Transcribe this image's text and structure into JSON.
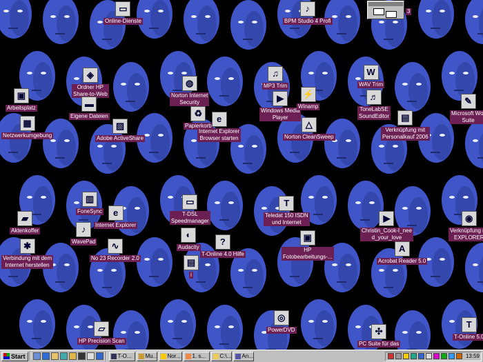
{
  "colors": {
    "label_bg": "#6b1f52",
    "label_text": "#ffffff",
    "face": "#3f55c8",
    "desktop_bg": "#000000",
    "taskbar": "#c0c0c0"
  },
  "icons": [
    {
      "id": "online-dienste",
      "label": "Online-Dienste",
      "glyph": "▭",
      "interactable": true
    },
    {
      "id": "bpm-studio",
      "label": "BPM Studio 4 Profi",
      "glyph": "♪",
      "interactable": true
    },
    {
      "id": "arbeitsplatz",
      "label": "Arbeitsplatz",
      "glyph": "▣",
      "interactable": true
    },
    {
      "id": "ordner-hp",
      "label": "Ordner HP\nShare-to-Web",
      "glyph": "◈",
      "interactable": true
    },
    {
      "id": "eigene-dateien",
      "label": "Eigene Dateien",
      "glyph": "▬",
      "interactable": true
    },
    {
      "id": "norton-security",
      "label": "Norton Internet\nSecurity",
      "glyph": "◍",
      "interactable": true
    },
    {
      "id": "mp3-trim",
      "label": "MP3 Trim",
      "glyph": "♫",
      "interactable": true
    },
    {
      "id": "wav-trim",
      "label": "WAV Trim",
      "glyph": "W",
      "interactable": true
    },
    {
      "id": "microsoft-works",
      "label": "Microsoft Wor\nSuite",
      "glyph": "✎",
      "interactable": true
    },
    {
      "id": "netzwerkumgebung",
      "label": "Netzwerkumgebung",
      "glyph": "▦",
      "interactable": true
    },
    {
      "id": "papierkorb",
      "label": "Papierkorb",
      "glyph": "♻",
      "interactable": true
    },
    {
      "id": "windows-media-player",
      "label": "Windows Media\nPlayer",
      "glyph": "▶",
      "interactable": true
    },
    {
      "id": "winamp",
      "label": "Winamp",
      "glyph": "⚡",
      "interactable": true
    },
    {
      "id": "tonelabse",
      "label": "ToneLabSE\nSoundEditor",
      "glyph": "♬",
      "interactable": true
    },
    {
      "id": "verknuepfung-personalkauf",
      "label": "Verknüpfung mit\nPersonalkauf 2006",
      "glyph": "▤",
      "interactable": true
    },
    {
      "id": "adobe-activeshare",
      "label": "Adobe ActiveShare",
      "glyph": "▨",
      "interactable": true
    },
    {
      "id": "internet-explorer-starten",
      "label": "Internet Explorer\nBrowser starten",
      "glyph": "e",
      "interactable": true
    },
    {
      "id": "norton-cleansweep",
      "label": "Norton CleanSweep",
      "glyph": "△",
      "interactable": true
    },
    {
      "id": "foresync",
      "label": "FoneSync",
      "glyph": "▥",
      "interactable": true
    },
    {
      "id": "tdsl-speedmanager",
      "label": "T-DSL\nSpeedmanager",
      "glyph": "▭",
      "interactable": true
    },
    {
      "id": "teledat-isdn",
      "label": "Teledat 150 ISDN\nund Internet",
      "glyph": "T",
      "interactable": true
    },
    {
      "id": "aktenkoffer",
      "label": "Aktenkoffer",
      "glyph": "▰",
      "interactable": true
    },
    {
      "id": "internet-explorer",
      "label": "Internet Explorer",
      "glyph": "e",
      "interactable": true
    },
    {
      "id": "christin-cook",
      "label": "Christin_Cook-I_nee\nd_your_love",
      "glyph": "▶",
      "interactable": true
    },
    {
      "id": "verknuepfung-explorer",
      "label": "Verknüpfung mi\nEXPLORER",
      "glyph": "◉",
      "interactable": true
    },
    {
      "id": "wavepad",
      "label": "WavePad",
      "glyph": "♪",
      "interactable": true
    },
    {
      "id": "audacity",
      "label": "Audacity",
      "glyph": "◐",
      "interactable": true
    },
    {
      "id": "hp-fotobearbeitung",
      "label": "HP\nFotobearbeitungs-...",
      "glyph": "▣",
      "interactable": true
    },
    {
      "id": "verbindung",
      "label": "Verbindung mit dem\nInternet herstellen",
      "glyph": "✱",
      "interactable": true
    },
    {
      "id": "no23-recorder",
      "label": "No 23 Recorder 2.0",
      "glyph": "∿",
      "interactable": true
    },
    {
      "id": "tonline-hilfe",
      "label": "T-Online 4.0 Hilfe",
      "glyph": "?",
      "interactable": true
    },
    {
      "id": "acrobat-reader",
      "label": "Acrobat Reader 5.0",
      "glyph": "A",
      "interactable": true
    },
    {
      "id": "i-icon",
      "label": "i",
      "glyph": "▤",
      "interactable": true
    },
    {
      "id": "powerdvd",
      "label": "PowerDVD",
      "glyph": "◎",
      "interactable": true
    },
    {
      "id": "hp-precision-scan",
      "label": "HP Precision Scan",
      "glyph": "▱",
      "interactable": true
    },
    {
      "id": "pc-suite",
      "label": "PC Suite für das",
      "glyph": "✣",
      "interactable": true
    },
    {
      "id": "tonline-5",
      "label": "T-Online 5.0",
      "glyph": "T",
      "interactable": true
    },
    {
      "id": "partial-3",
      "label": "3",
      "glyph": "",
      "interactable": false
    }
  ],
  "taskbar": {
    "start_label": "Start",
    "tasks": [
      {
        "label": "T-O..."
      },
      {
        "label": "Mu..."
      },
      {
        "label": "Nor..."
      },
      {
        "label": "1. s..."
      },
      {
        "label": "C:\\..."
      },
      {
        "label": "An..."
      }
    ],
    "clock": "13:59"
  }
}
